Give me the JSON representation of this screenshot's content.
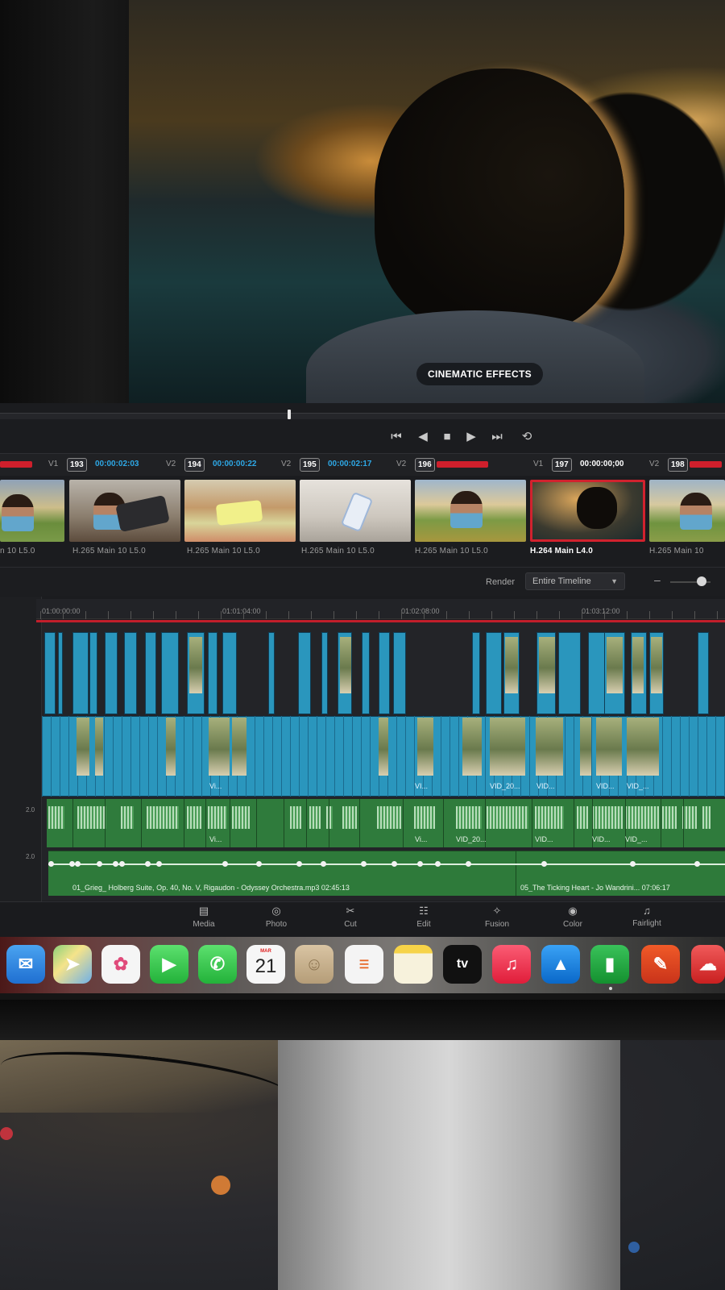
{
  "viewer": {
    "caption": "CINEMATIC EFFECTS"
  },
  "transport": {
    "buttons": [
      {
        "name": "skip-to-start-icon",
        "glyph": "⏮"
      },
      {
        "name": "play-reverse-icon",
        "glyph": "◀"
      },
      {
        "name": "stop-icon",
        "glyph": "■"
      },
      {
        "name": "play-icon",
        "glyph": "▶"
      },
      {
        "name": "skip-to-end-icon",
        "glyph": "⏭"
      },
      {
        "name": "loop-icon",
        "glyph": "⟲"
      }
    ]
  },
  "clips": {
    "header": [
      {
        "track": "V1",
        "num": "193",
        "timecode": "00:00:02:03",
        "tc_color": "#2ea8e6"
      },
      {
        "track": "V2",
        "num": "194",
        "timecode": "00:00:00:22",
        "tc_color": "#2ea8e6"
      },
      {
        "track": "V2",
        "num": "195",
        "timecode": "00:00:02:17",
        "tc_color": "#2ea8e6"
      },
      {
        "track": "V2",
        "num": "196",
        "timecode": "",
        "tc_color": "#cf1f2c"
      },
      {
        "track": "V1",
        "num": "197",
        "timecode": "00:00:00;00",
        "tc_color": "#ffffff"
      },
      {
        "track": "V2",
        "num": "198",
        "timecode": "",
        "tc_color": "#cf1f2c"
      }
    ],
    "codecs": [
      "n 10 L5.0",
      "H.265 Main 10 L5.0",
      "H.265 Main 10 L5.0",
      "H.265 Main 10 L5.0",
      "H.265 Main 10 L5.0",
      "H.264 Main L4.0",
      "H.265 Main 10"
    ],
    "selected_index": 5
  },
  "render": {
    "label": "Render",
    "value": "Entire Timeline"
  },
  "ruler": [
    "01:00:00:00",
    "01:01:04:00",
    "01:02:08:00",
    "01:03:12:00"
  ],
  "tracks": {
    "a1_level": "2.0",
    "a2_level": "2.0"
  },
  "video_labels": [
    "Vi...",
    "VI...",
    "VID_20...",
    "VID...",
    "VID...",
    "VID_..."
  ],
  "audio_labels": [
    "Vi...",
    "Vi...",
    "VID_20...",
    "VID...",
    "VID...",
    "VID_..."
  ],
  "music": {
    "clip1": "01_Grieg_ Holberg Suite, Op. 40, No. V, Rigaudon - Odyssey Orchestra.mp3  02:45:13",
    "clip2": "05_The Ticking Heart - Jo Wandrini...  07:06:17"
  },
  "pages": [
    {
      "label": "Media",
      "glyph": "▤",
      "name": "media-page-button"
    },
    {
      "label": "Photo",
      "glyph": "◎",
      "name": "photo-page-button"
    },
    {
      "label": "Cut",
      "glyph": "✂",
      "name": "cut-page-button"
    },
    {
      "label": "Edit",
      "glyph": "☷",
      "name": "edit-page-button"
    },
    {
      "label": "Fusion",
      "glyph": "✧",
      "name": "fusion-page-button"
    },
    {
      "label": "Color",
      "glyph": "◉",
      "name": "color-page-button"
    },
    {
      "label": "Fairlight",
      "glyph": "♫",
      "name": "fairlight-page-button"
    }
  ],
  "dock": {
    "calendar_month": "MAR",
    "calendar_day": "21",
    "tv_label": "tv"
  },
  "colors": {
    "video_clip": "#2a96bd",
    "audio_clip": "#2f7b3c",
    "selection_red": "#cf1f2c",
    "timecode_blue": "#2ea8e6"
  }
}
